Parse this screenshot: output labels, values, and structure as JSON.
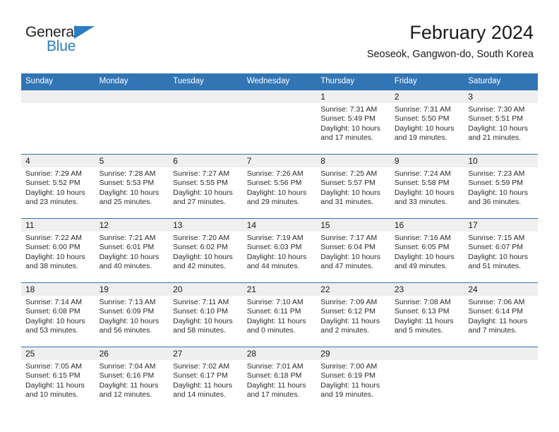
{
  "brand": {
    "name_top": "General",
    "name_bottom": "Blue",
    "triangle_color": "#2b7cc4",
    "text_color": "#231f20"
  },
  "header": {
    "month_title": "February 2024",
    "location": "Seoseok, Gangwon-do, South Korea"
  },
  "colors": {
    "header_blue": "#3175b5",
    "daynum_strip": "#efefef",
    "row_rule": "#3175b5",
    "text": "#2a2a2a"
  },
  "weekday_headers": [
    "Sunday",
    "Monday",
    "Tuesday",
    "Wednesday",
    "Thursday",
    "Friday",
    "Saturday"
  ],
  "weeks": [
    [
      {
        "day": "",
        "sunrise": "",
        "sunset": "",
        "daylight_line1": "",
        "daylight_line2": ""
      },
      {
        "day": "",
        "sunrise": "",
        "sunset": "",
        "daylight_line1": "",
        "daylight_line2": ""
      },
      {
        "day": "",
        "sunrise": "",
        "sunset": "",
        "daylight_line1": "",
        "daylight_line2": ""
      },
      {
        "day": "",
        "sunrise": "",
        "sunset": "",
        "daylight_line1": "",
        "daylight_line2": ""
      },
      {
        "day": "1",
        "sunrise": "Sunrise: 7:31 AM",
        "sunset": "Sunset: 5:49 PM",
        "daylight_line1": "Daylight: 10 hours",
        "daylight_line2": "and 17 minutes."
      },
      {
        "day": "2",
        "sunrise": "Sunrise: 7:31 AM",
        "sunset": "Sunset: 5:50 PM",
        "daylight_line1": "Daylight: 10 hours",
        "daylight_line2": "and 19 minutes."
      },
      {
        "day": "3",
        "sunrise": "Sunrise: 7:30 AM",
        "sunset": "Sunset: 5:51 PM",
        "daylight_line1": "Daylight: 10 hours",
        "daylight_line2": "and 21 minutes."
      }
    ],
    [
      {
        "day": "4",
        "sunrise": "Sunrise: 7:29 AM",
        "sunset": "Sunset: 5:52 PM",
        "daylight_line1": "Daylight: 10 hours",
        "daylight_line2": "and 23 minutes."
      },
      {
        "day": "5",
        "sunrise": "Sunrise: 7:28 AM",
        "sunset": "Sunset: 5:53 PM",
        "daylight_line1": "Daylight: 10 hours",
        "daylight_line2": "and 25 minutes."
      },
      {
        "day": "6",
        "sunrise": "Sunrise: 7:27 AM",
        "sunset": "Sunset: 5:55 PM",
        "daylight_line1": "Daylight: 10 hours",
        "daylight_line2": "and 27 minutes."
      },
      {
        "day": "7",
        "sunrise": "Sunrise: 7:26 AM",
        "sunset": "Sunset: 5:56 PM",
        "daylight_line1": "Daylight: 10 hours",
        "daylight_line2": "and 29 minutes."
      },
      {
        "day": "8",
        "sunrise": "Sunrise: 7:25 AM",
        "sunset": "Sunset: 5:57 PM",
        "daylight_line1": "Daylight: 10 hours",
        "daylight_line2": "and 31 minutes."
      },
      {
        "day": "9",
        "sunrise": "Sunrise: 7:24 AM",
        "sunset": "Sunset: 5:58 PM",
        "daylight_line1": "Daylight: 10 hours",
        "daylight_line2": "and 33 minutes."
      },
      {
        "day": "10",
        "sunrise": "Sunrise: 7:23 AM",
        "sunset": "Sunset: 5:59 PM",
        "daylight_line1": "Daylight: 10 hours",
        "daylight_line2": "and 36 minutes."
      }
    ],
    [
      {
        "day": "11",
        "sunrise": "Sunrise: 7:22 AM",
        "sunset": "Sunset: 6:00 PM",
        "daylight_line1": "Daylight: 10 hours",
        "daylight_line2": "and 38 minutes."
      },
      {
        "day": "12",
        "sunrise": "Sunrise: 7:21 AM",
        "sunset": "Sunset: 6:01 PM",
        "daylight_line1": "Daylight: 10 hours",
        "daylight_line2": "and 40 minutes."
      },
      {
        "day": "13",
        "sunrise": "Sunrise: 7:20 AM",
        "sunset": "Sunset: 6:02 PM",
        "daylight_line1": "Daylight: 10 hours",
        "daylight_line2": "and 42 minutes."
      },
      {
        "day": "14",
        "sunrise": "Sunrise: 7:19 AM",
        "sunset": "Sunset: 6:03 PM",
        "daylight_line1": "Daylight: 10 hours",
        "daylight_line2": "and 44 minutes."
      },
      {
        "day": "15",
        "sunrise": "Sunrise: 7:17 AM",
        "sunset": "Sunset: 6:04 PM",
        "daylight_line1": "Daylight: 10 hours",
        "daylight_line2": "and 47 minutes."
      },
      {
        "day": "16",
        "sunrise": "Sunrise: 7:16 AM",
        "sunset": "Sunset: 6:05 PM",
        "daylight_line1": "Daylight: 10 hours",
        "daylight_line2": "and 49 minutes."
      },
      {
        "day": "17",
        "sunrise": "Sunrise: 7:15 AM",
        "sunset": "Sunset: 6:07 PM",
        "daylight_line1": "Daylight: 10 hours",
        "daylight_line2": "and 51 minutes."
      }
    ],
    [
      {
        "day": "18",
        "sunrise": "Sunrise: 7:14 AM",
        "sunset": "Sunset: 6:08 PM",
        "daylight_line1": "Daylight: 10 hours",
        "daylight_line2": "and 53 minutes."
      },
      {
        "day": "19",
        "sunrise": "Sunrise: 7:13 AM",
        "sunset": "Sunset: 6:09 PM",
        "daylight_line1": "Daylight: 10 hours",
        "daylight_line2": "and 56 minutes."
      },
      {
        "day": "20",
        "sunrise": "Sunrise: 7:11 AM",
        "sunset": "Sunset: 6:10 PM",
        "daylight_line1": "Daylight: 10 hours",
        "daylight_line2": "and 58 minutes."
      },
      {
        "day": "21",
        "sunrise": "Sunrise: 7:10 AM",
        "sunset": "Sunset: 6:11 PM",
        "daylight_line1": "Daylight: 11 hours",
        "daylight_line2": "and 0 minutes."
      },
      {
        "day": "22",
        "sunrise": "Sunrise: 7:09 AM",
        "sunset": "Sunset: 6:12 PM",
        "daylight_line1": "Daylight: 11 hours",
        "daylight_line2": "and 2 minutes."
      },
      {
        "day": "23",
        "sunrise": "Sunrise: 7:08 AM",
        "sunset": "Sunset: 6:13 PM",
        "daylight_line1": "Daylight: 11 hours",
        "daylight_line2": "and 5 minutes."
      },
      {
        "day": "24",
        "sunrise": "Sunrise: 7:06 AM",
        "sunset": "Sunset: 6:14 PM",
        "daylight_line1": "Daylight: 11 hours",
        "daylight_line2": "and 7 minutes."
      }
    ],
    [
      {
        "day": "25",
        "sunrise": "Sunrise: 7:05 AM",
        "sunset": "Sunset: 6:15 PM",
        "daylight_line1": "Daylight: 11 hours",
        "daylight_line2": "and 10 minutes."
      },
      {
        "day": "26",
        "sunrise": "Sunrise: 7:04 AM",
        "sunset": "Sunset: 6:16 PM",
        "daylight_line1": "Daylight: 11 hours",
        "daylight_line2": "and 12 minutes."
      },
      {
        "day": "27",
        "sunrise": "Sunrise: 7:02 AM",
        "sunset": "Sunset: 6:17 PM",
        "daylight_line1": "Daylight: 11 hours",
        "daylight_line2": "and 14 minutes."
      },
      {
        "day": "28",
        "sunrise": "Sunrise: 7:01 AM",
        "sunset": "Sunset: 6:18 PM",
        "daylight_line1": "Daylight: 11 hours",
        "daylight_line2": "and 17 minutes."
      },
      {
        "day": "29",
        "sunrise": "Sunrise: 7:00 AM",
        "sunset": "Sunset: 6:19 PM",
        "daylight_line1": "Daylight: 11 hours",
        "daylight_line2": "and 19 minutes."
      },
      {
        "day": "",
        "sunrise": "",
        "sunset": "",
        "daylight_line1": "",
        "daylight_line2": ""
      },
      {
        "day": "",
        "sunrise": "",
        "sunset": "",
        "daylight_line1": "",
        "daylight_line2": ""
      }
    ]
  ]
}
